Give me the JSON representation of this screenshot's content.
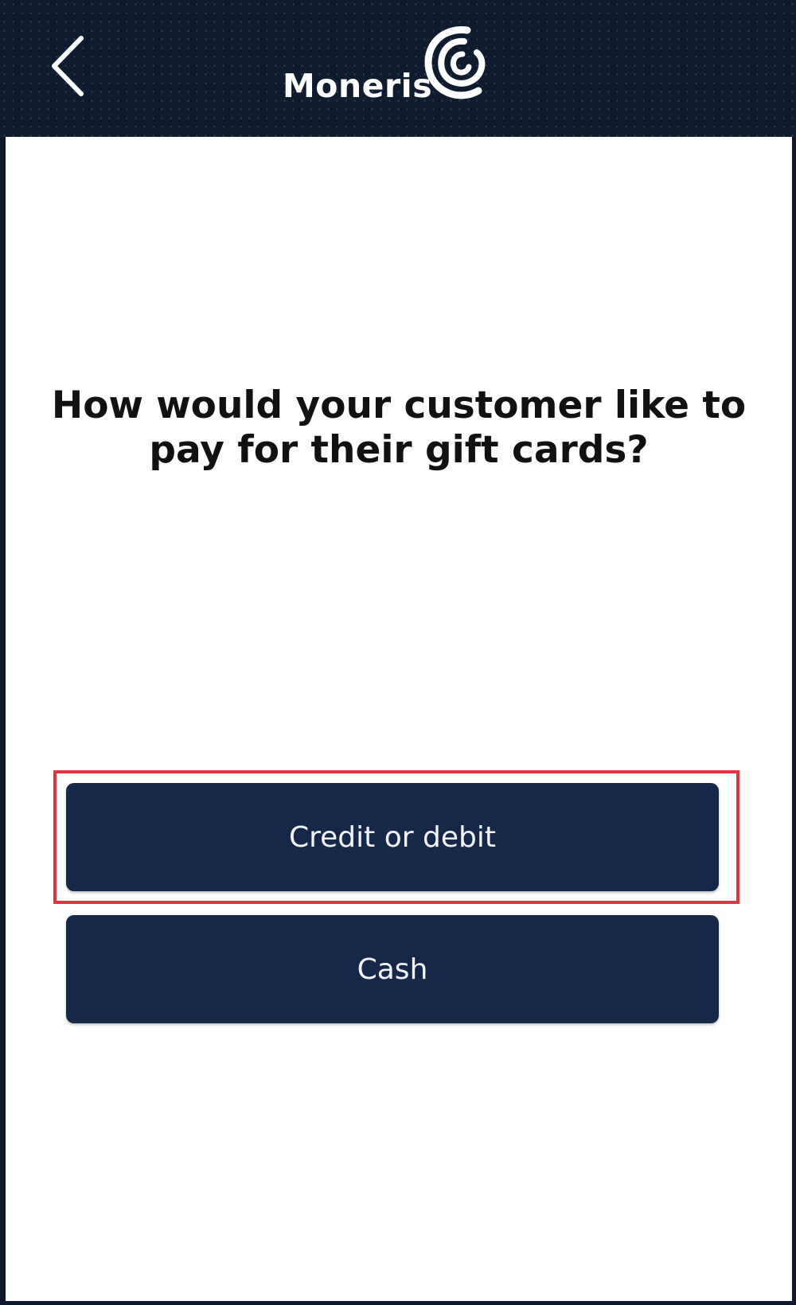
{
  "header": {
    "back_icon": "chevron-left-icon",
    "logo_text": "Moneris",
    "logo_icon": "moneris-swirl-icon",
    "background_color": "#0f1c30"
  },
  "main": {
    "question": "How would your customer like to pay for their gift cards?"
  },
  "payment_options": {
    "credit_label": "Credit or debit",
    "cash_label": "Cash"
  },
  "colors": {
    "button_bg": "#15284a",
    "highlight": "#e0323f"
  }
}
